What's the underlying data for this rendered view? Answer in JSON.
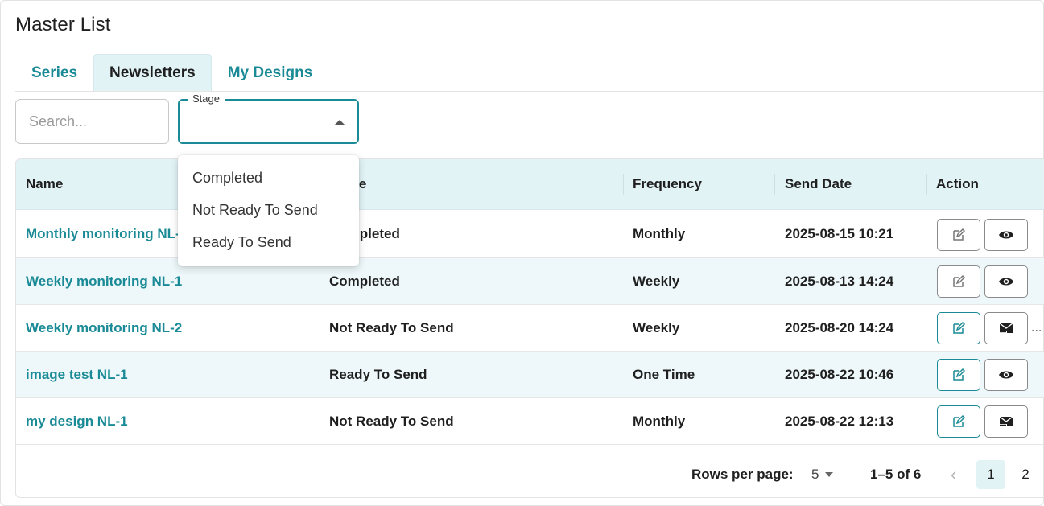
{
  "page": {
    "title": "Master List"
  },
  "tabs": [
    {
      "label": "Series",
      "active": false
    },
    {
      "label": "Newsletters",
      "active": true
    },
    {
      "label": "My Designs",
      "active": false
    }
  ],
  "search": {
    "placeholder": "Search...",
    "value": ""
  },
  "stage_filter": {
    "label": "Stage",
    "value": "",
    "open": true,
    "options": [
      "Completed",
      "Not Ready To Send",
      "Ready To Send"
    ]
  },
  "table": {
    "columns": [
      "Name",
      "Stage",
      "Frequency",
      "Send Date",
      "Action"
    ],
    "rows": [
      {
        "name": "Monthly monitoring NL-1",
        "stage": "Completed",
        "frequency": "Monthly",
        "send_date": "2025-08-15 10:21",
        "actions": [
          "edit-icon",
          "eye-icon"
        ]
      },
      {
        "name": "Weekly monitoring NL-1",
        "stage": "Completed",
        "frequency": "Weekly",
        "send_date": "2025-08-13 14:24",
        "actions": [
          "edit-icon",
          "eye-icon"
        ]
      },
      {
        "name": "Weekly monitoring NL-2",
        "stage": "Not Ready To Send",
        "frequency": "Weekly",
        "send_date": "2025-08-20 14:24",
        "actions": [
          "edit-icon",
          "send-mail-icon"
        ],
        "more": "..."
      },
      {
        "name": "image test NL-1",
        "stage": "Ready To Send",
        "frequency": "One Time",
        "send_date": "2025-08-22 10:46",
        "actions": [
          "edit-icon",
          "eye-icon"
        ]
      },
      {
        "name": "my design NL-1",
        "stage": "Not Ready To Send",
        "frequency": "Monthly",
        "send_date": "2025-08-22 12:13",
        "actions": [
          "edit-icon",
          "send-mail-icon"
        ]
      }
    ]
  },
  "pagination": {
    "rows_per_page_label": "Rows per page:",
    "rows_per_page": "5",
    "range": "1–5 of 6",
    "pages": [
      "1",
      "2"
    ],
    "current_page": "1"
  },
  "colors": {
    "accent": "#1a8a96",
    "header_bg": "#e2f3f6",
    "row_alt_bg": "#eef8fa"
  }
}
